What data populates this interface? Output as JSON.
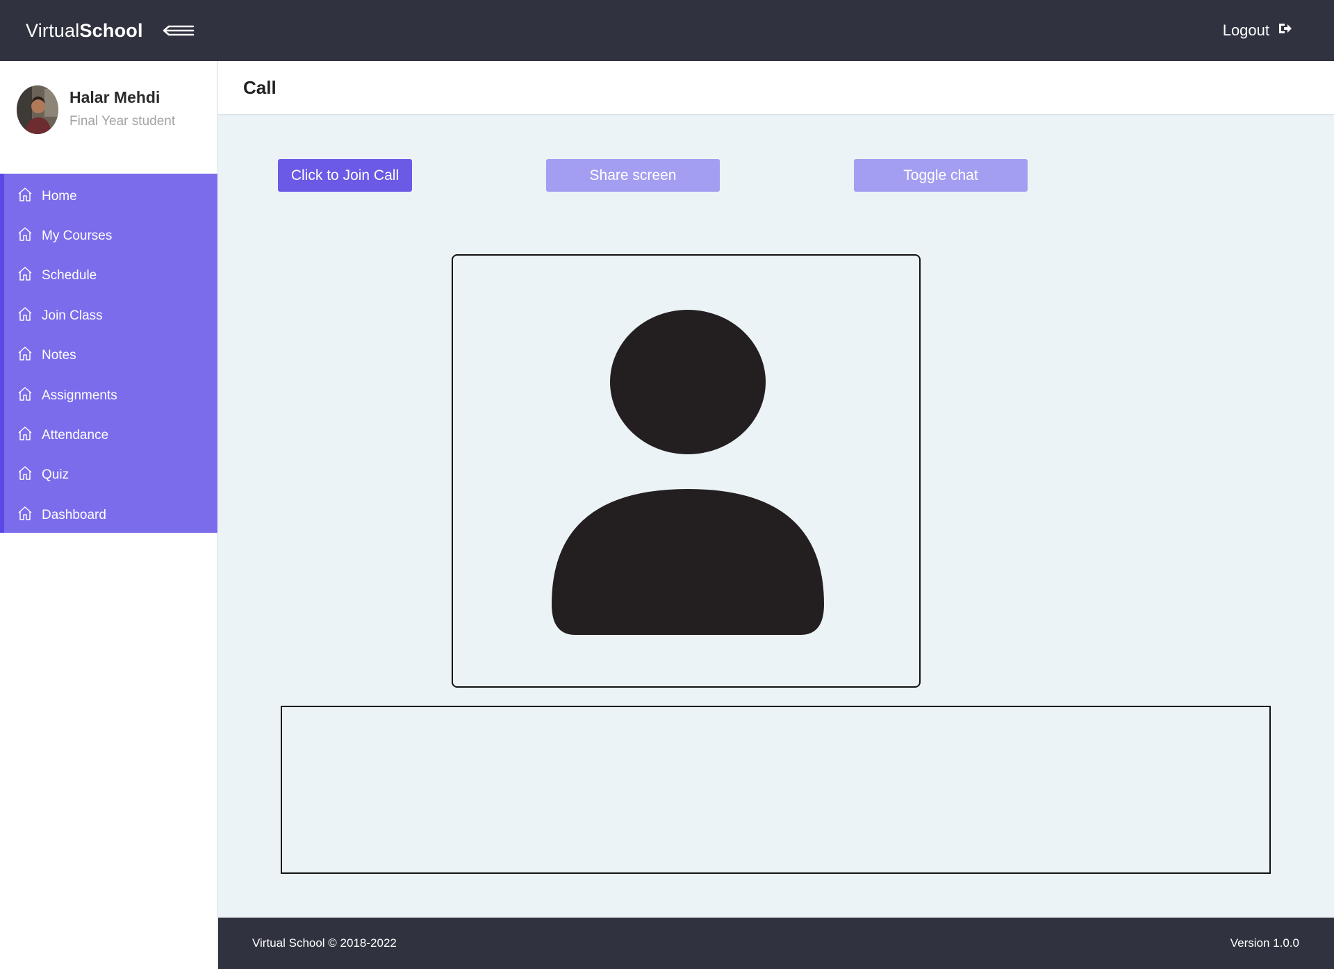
{
  "header": {
    "brand_light": "Virtual",
    "brand_bold": "School",
    "menu_icon": "menu-arrow-icon",
    "logout_label": "Logout",
    "logout_icon": "sign-out-icon",
    "background": "#30333f"
  },
  "profile": {
    "name": "Halar Mehdi",
    "role": "Final Year student"
  },
  "sidebar": {
    "accent": "#7b6cec",
    "items": [
      {
        "label": "Home",
        "icon": "home-icon"
      },
      {
        "label": "My Courses",
        "icon": "home-icon"
      },
      {
        "label": "Schedule",
        "icon": "home-icon"
      },
      {
        "label": "Join Class",
        "icon": "home-icon"
      },
      {
        "label": "Notes",
        "icon": "home-icon"
      },
      {
        "label": "Assignments",
        "icon": "home-icon"
      },
      {
        "label": "Attendance",
        "icon": "home-icon"
      },
      {
        "label": "Quiz",
        "icon": "home-icon"
      },
      {
        "label": "Dashboard",
        "icon": "home-icon"
      }
    ]
  },
  "page": {
    "title": "Call"
  },
  "controls": {
    "join_label": "Click to Join Call",
    "share_label": "Share screen",
    "chat_label": "Toggle chat",
    "primary_color": "#6a5ae6",
    "disabled_color": "#a39ef1"
  },
  "video": {
    "placeholder_icon": "user-silhouette-icon"
  },
  "footer": {
    "copyright": "Virtual School © 2018-2022",
    "version": "Version 1.0.0"
  }
}
